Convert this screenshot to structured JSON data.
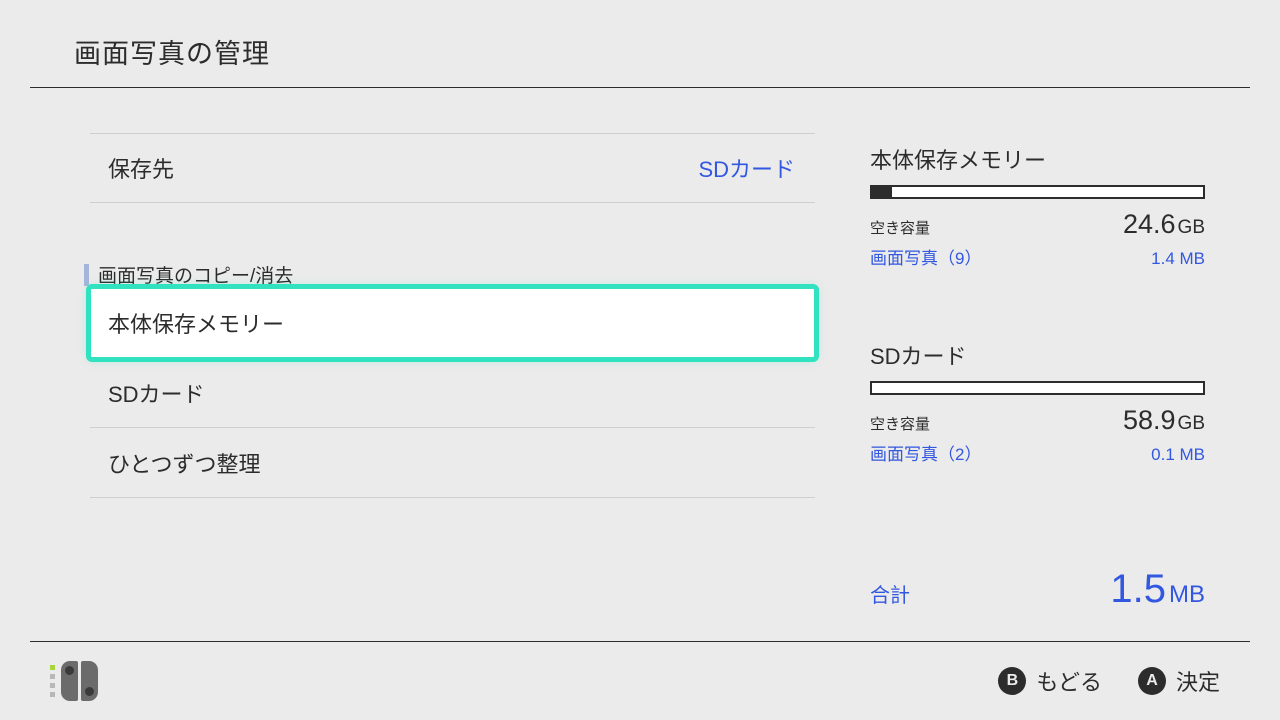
{
  "header": {
    "title": "画面写真の管理"
  },
  "left": {
    "saveDest": {
      "label": "保存先",
      "value": "SDカード"
    },
    "sectionLabel": "画面写真のコピー/消去",
    "items": [
      {
        "label": "本体保存メモリー",
        "selected": true
      },
      {
        "label": "SDカード",
        "selected": false
      },
      {
        "label": "ひとつずつ整理",
        "selected": false
      }
    ]
  },
  "storage": {
    "system": {
      "title": "本体保存メモリー",
      "fillPct": 6,
      "freeLabel": "空き容量",
      "freeValue": "24.6",
      "freeUnit": "GB",
      "screenshots": "画面写真（9）",
      "screenshotsSize": "1.4 MB"
    },
    "sd": {
      "title": "SDカード",
      "fillPct": 0,
      "freeLabel": "空き容量",
      "freeValue": "58.9",
      "freeUnit": "GB",
      "screenshots": "画面写真（2）",
      "screenshotsSize": "0.1 MB"
    },
    "total": {
      "label": "合計",
      "value": "1.5",
      "unit": "MB"
    }
  },
  "footer": {
    "back": {
      "glyph": "B",
      "label": "もどる"
    },
    "ok": {
      "glyph": "A",
      "label": "決定"
    }
  }
}
